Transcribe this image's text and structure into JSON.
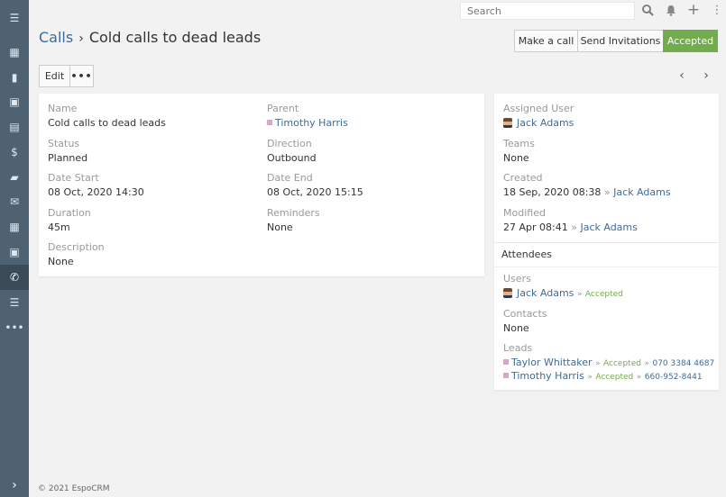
{
  "search": {
    "placeholder": "Search"
  },
  "breadcrumb": {
    "parent": "Calls",
    "separator": "›",
    "title": "Cold calls to dead leads"
  },
  "actions": {
    "make_call": "Make a call",
    "send_invitations": "Send Invitations",
    "status": "Accepted",
    "edit": "Edit",
    "more": "•••"
  },
  "colors": {
    "accent": "#72ac4d",
    "sidebar": "#4f6272",
    "link": "#3f6b9a"
  },
  "sidebar": {
    "items": [
      {
        "name": "dashboard-icon",
        "glyph": "▦"
      },
      {
        "name": "accounts-icon",
        "glyph": "▮"
      },
      {
        "name": "contacts-icon",
        "glyph": "▣"
      },
      {
        "name": "leads-icon",
        "glyph": "▤"
      },
      {
        "name": "opportunities-icon",
        "glyph": "$"
      },
      {
        "name": "cases-icon",
        "glyph": "▰"
      },
      {
        "name": "email-icon",
        "glyph": "✉"
      },
      {
        "name": "calendar-icon",
        "glyph": "▦"
      },
      {
        "name": "meetings-icon",
        "glyph": "▣"
      },
      {
        "name": "calls-icon",
        "glyph": "✆"
      },
      {
        "name": "tasks-icon",
        "glyph": "☰"
      },
      {
        "name": "more-icon",
        "glyph": "•••"
      }
    ]
  },
  "details": {
    "name": {
      "label": "Name",
      "value": "Cold calls to dead leads"
    },
    "parent": {
      "label": "Parent",
      "value": "Timothy Harris"
    },
    "status": {
      "label": "Status",
      "value": "Planned"
    },
    "direction": {
      "label": "Direction",
      "value": "Outbound"
    },
    "date_start": {
      "label": "Date Start",
      "value": "08 Oct, 2020 14:30"
    },
    "date_end": {
      "label": "Date End",
      "value": "08 Oct, 2020 15:15"
    },
    "duration": {
      "label": "Duration",
      "value": "45m"
    },
    "reminders": {
      "label": "Reminders",
      "value": "None"
    },
    "description": {
      "label": "Description",
      "value": "None"
    }
  },
  "side": {
    "assigned_user": {
      "label": "Assigned User",
      "value": "Jack Adams"
    },
    "teams": {
      "label": "Teams",
      "value": "None"
    },
    "created": {
      "label": "Created",
      "date": "18 Sep, 2020 08:38",
      "sep": "»",
      "user": "Jack Adams"
    },
    "modified": {
      "label": "Modified",
      "date": "27 Apr 08:41",
      "sep": "»",
      "user": "Jack Adams"
    }
  },
  "attendees": {
    "title": "Attendees",
    "users": {
      "label": "Users",
      "name": "Jack Adams",
      "status": "Accepted"
    },
    "contacts": {
      "label": "Contacts",
      "value": "None"
    },
    "leads": {
      "label": "Leads",
      "items": [
        {
          "name": "Taylor Whittaker",
          "status": "Accepted",
          "phone": "070 3384 4687"
        },
        {
          "name": "Timothy Harris",
          "status": "Accepted",
          "phone": "660-952-8441"
        }
      ]
    }
  },
  "footer": {
    "text": "© 2021 EspoCRM"
  }
}
